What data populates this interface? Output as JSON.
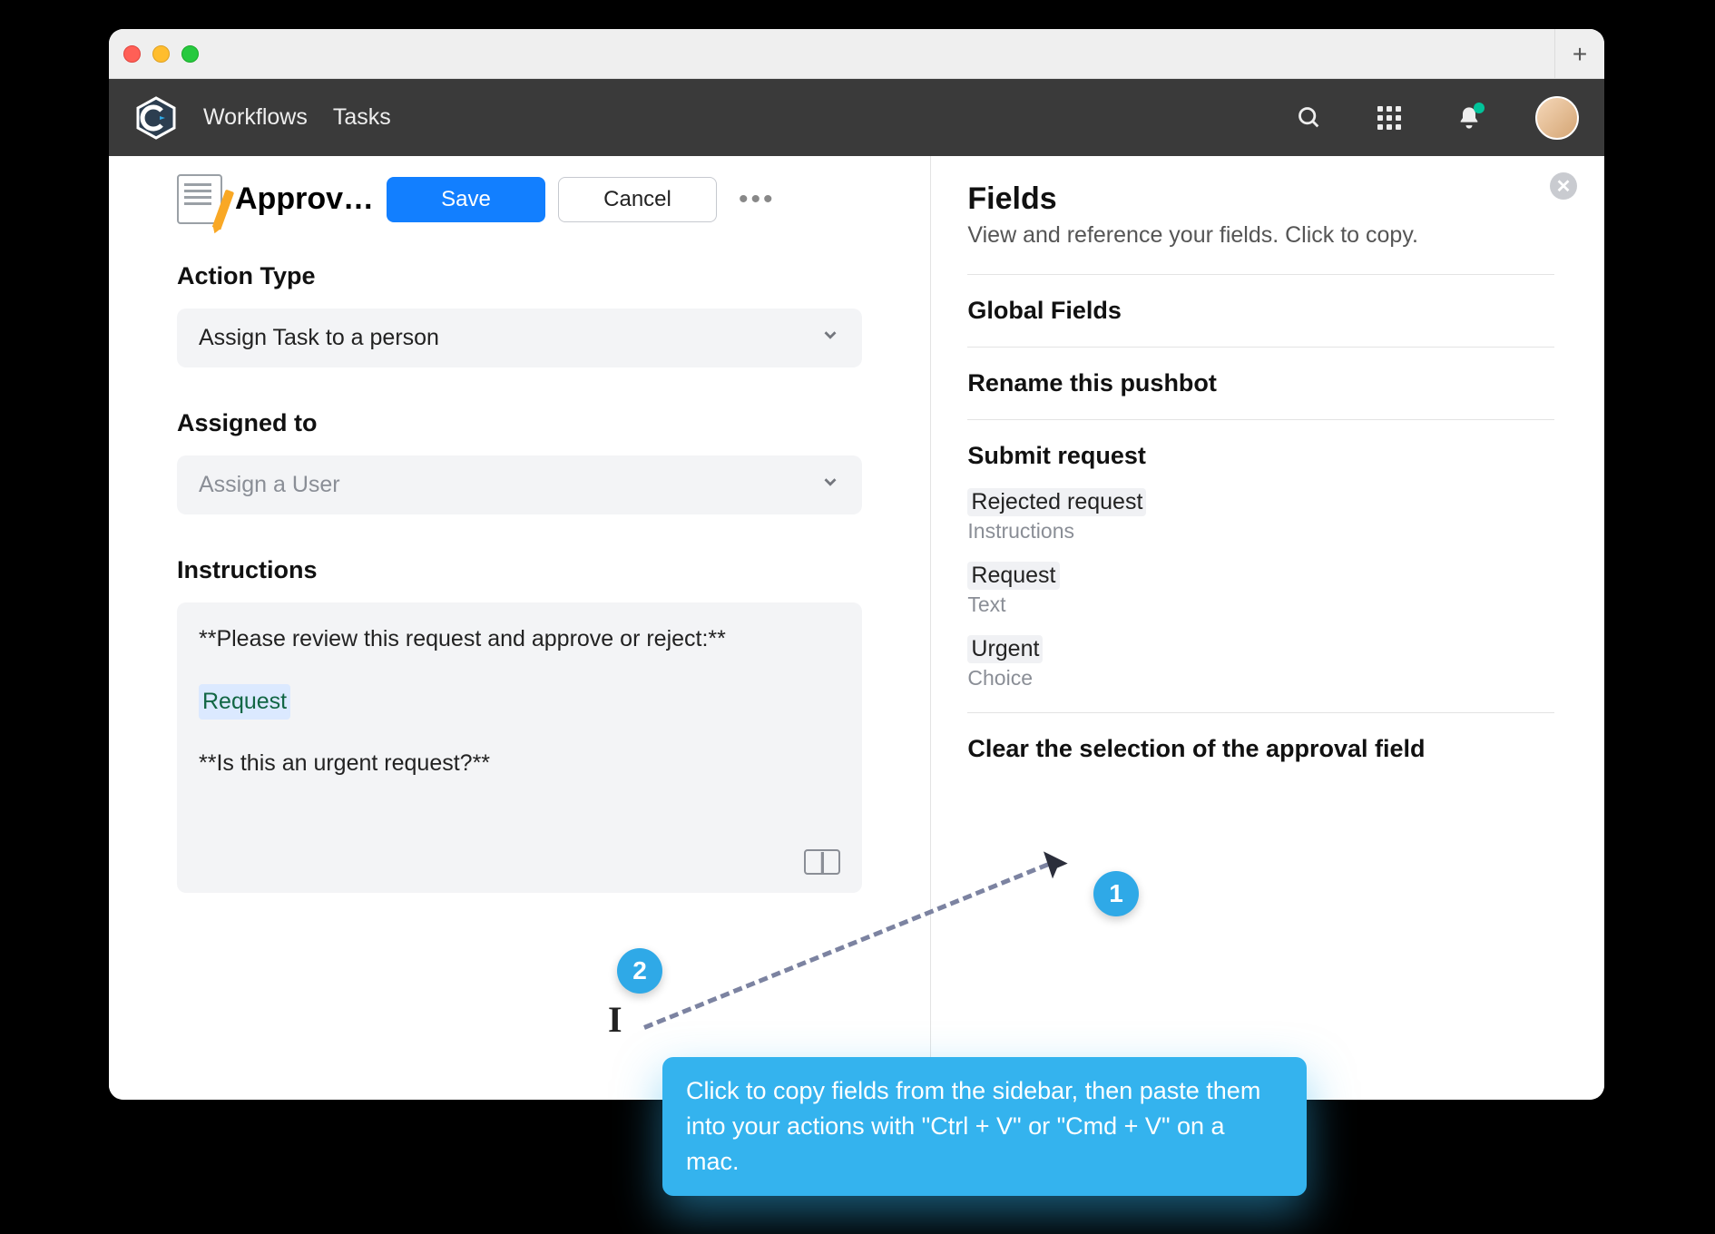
{
  "header": {
    "nav": [
      "Workflows",
      "Tasks"
    ]
  },
  "page": {
    "title": "Approv…",
    "save_label": "Save",
    "cancel_label": "Cancel"
  },
  "action_type": {
    "label": "Action Type",
    "value": "Assign Task to a person"
  },
  "assigned_to": {
    "label": "Assigned to",
    "placeholder": "Assign a User"
  },
  "instructions": {
    "label": "Instructions",
    "line1": "**Please review this request and approve or reject:**",
    "chip": "Request",
    "line3": "**Is this an urgent request?**"
  },
  "right": {
    "title": "Fields",
    "subtitle": "View and reference your fields. Click to copy.",
    "sections": {
      "global": "Global Fields",
      "rename": "Rename this pushbot",
      "submit": "Submit request",
      "clear": "Clear the selection of the approval field"
    },
    "submit_items": [
      {
        "name": "Rejected request",
        "type": "Instructions"
      },
      {
        "name": "Request",
        "type": "Text"
      },
      {
        "name": "Urgent",
        "type": "Choice"
      }
    ]
  },
  "callouts": {
    "badge1": "1",
    "badge2": "2",
    "tooltip": "Click to copy fields from the sidebar, then paste them into your actions with \"Ctrl + V\" or \"Cmd + V\" on a mac."
  }
}
